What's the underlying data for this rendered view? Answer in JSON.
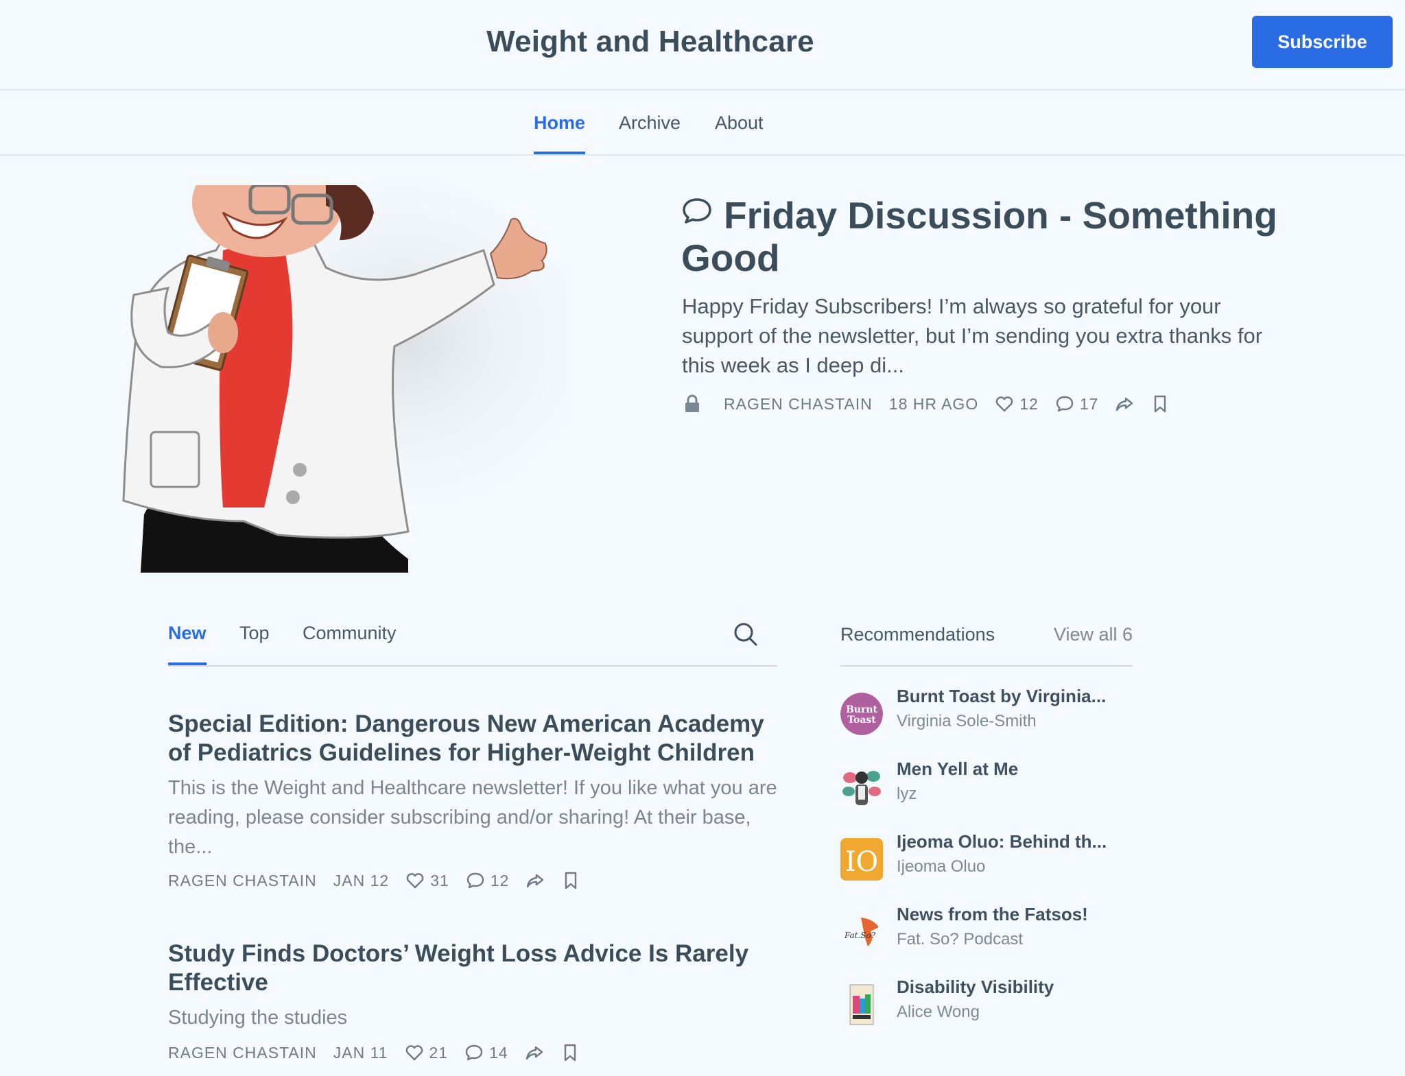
{
  "header": {
    "site_title": "Weight and Healthcare",
    "subscribe_label": "Subscribe"
  },
  "nav": {
    "items": [
      "Home",
      "Archive",
      "About"
    ],
    "active": "Home"
  },
  "featured": {
    "title": "Friday Discussion - Something Good",
    "excerpt": "Happy Friday Subscribers! I’m always so grateful for your support of the newsletter, but I’m sending you extra thanks for this week as I deep di...",
    "author": "RAGEN CHASTAIN",
    "time": "18 HR AGO",
    "likes": "12",
    "comments": "17",
    "paid": true,
    "icons": [
      "chat-bubble-icon",
      "lock-icon",
      "heart-icon",
      "comment-icon",
      "share-icon",
      "bookmark-icon"
    ]
  },
  "feed": {
    "tabs": [
      "New",
      "Top",
      "Community"
    ],
    "active_tab": "New",
    "posts": [
      {
        "title": "Special Edition: Dangerous New American Academy of Pediatrics Guidelines for Higher-Weight Children",
        "subtitle": "This is the Weight and Healthcare newsletter! If you like what you are reading, please consider subscribing and/or sharing! At their base, the...",
        "author": "RAGEN CHASTAIN",
        "date": "JAN 12",
        "likes": "31",
        "comments": "12"
      },
      {
        "title": "Study Finds Doctors’ Weight Loss Advice Is Rarely Effective",
        "subtitle": "Studying the studies",
        "author": "RAGEN CHASTAIN",
        "date": "JAN 11",
        "likes": "21",
        "comments": "14"
      }
    ]
  },
  "recommendations": {
    "title": "Recommendations",
    "view_all": "View all 6",
    "items": [
      {
        "name": "Burnt Toast by Virginia...",
        "author": "Virginia Sole-Smith",
        "avatar_text_1": "Burnt",
        "avatar_text_2": "Toast"
      },
      {
        "name": "Men Yell at Me",
        "author": "lyz"
      },
      {
        "name": "Ijeoma Oluo: Behind th...",
        "author": "Ijeoma Oluo",
        "avatar_text": "IO"
      },
      {
        "name": "News from the Fatsos!",
        "author": "Fat. So? Podcast",
        "avatar_text": "Fat.So?"
      },
      {
        "name": "Disability Visibility",
        "author": "Alice Wong"
      }
    ]
  },
  "colors": {
    "accent": "#2a6ce3",
    "background": "#f5fafe",
    "text": "#3b4c5a",
    "muted": "#7a858f"
  }
}
